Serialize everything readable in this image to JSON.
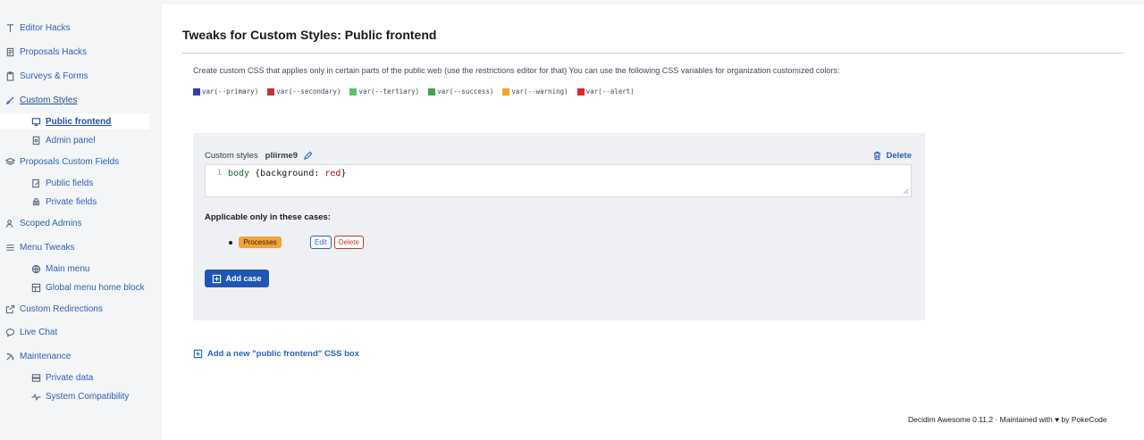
{
  "sidebar": {
    "items": [
      {
        "label": "Editor Hacks",
        "icon": "text-icon",
        "level": 1
      },
      {
        "label": "Proposals Hacks",
        "icon": "document-icon",
        "level": 1
      },
      {
        "label": "Surveys & Forms",
        "icon": "clipboard-icon",
        "level": 1
      },
      {
        "label": "Custom Styles",
        "icon": "brush-icon",
        "level": 1,
        "state": "active-parent"
      },
      {
        "label": "Public frontend",
        "icon": "monitor-icon",
        "level": 2,
        "state": "active"
      },
      {
        "label": "Admin panel",
        "icon": "file-icon",
        "level": 2
      },
      {
        "label": "Proposals Custom Fields",
        "icon": "stack-icon",
        "level": 1
      },
      {
        "label": "Public fields",
        "icon": "edit-file-icon",
        "level": 2
      },
      {
        "label": "Private fields",
        "icon": "incognito-icon",
        "level": 2
      },
      {
        "label": "Scoped Admins",
        "icon": "users-icon",
        "level": 1
      },
      {
        "label": "Menu Tweaks",
        "icon": "menu-icon",
        "level": 1
      },
      {
        "label": "Main menu",
        "icon": "globe-icon",
        "level": 2
      },
      {
        "label": "Global menu home block",
        "icon": "layout-icon",
        "level": 2
      },
      {
        "label": "Custom Redirections",
        "icon": "external-link-icon",
        "level": 1
      },
      {
        "label": "Live Chat",
        "icon": "chat-icon",
        "level": 1
      },
      {
        "label": "Maintenance",
        "icon": "tools-icon",
        "level": 1
      },
      {
        "label": "Private data",
        "icon": "database-icon",
        "level": 2
      },
      {
        "label": "System Compatibility",
        "icon": "pulse-icon",
        "level": 2
      }
    ]
  },
  "main": {
    "title": "Tweaks for Custom Styles: Public frontend",
    "description": "Create custom CSS that applies only in certain parts of the public web (use the restrictions editor for that) You can use the following CSS variables for organization customized colors:",
    "css_vars": [
      {
        "label": "var(--primary)",
        "color": "#3b3bb5"
      },
      {
        "label": "var(--secondary)",
        "color": "#b83a3a"
      },
      {
        "label": "var(--tertiary)",
        "color": "#5cc26a"
      },
      {
        "label": "var(--success)",
        "color": "#3aa851"
      },
      {
        "label": "var(--warning)",
        "color": "#f5a623"
      },
      {
        "label": "var(--alert)",
        "color": "#e02727"
      }
    ],
    "box": {
      "label": "Custom styles",
      "name": "pliirme9",
      "delete_label": "Delete",
      "line_number": "1",
      "code_selector": "body",
      "code_open": " {background: ",
      "code_value": "red",
      "code_close": "}",
      "cases_title": "Applicable only in these cases:",
      "cases": [
        {
          "badge": "Processes",
          "edit_label": "Edit",
          "delete_label": "Delete"
        }
      ],
      "add_case_label": "Add case"
    },
    "add_box_label": "Add a new \"public frontend\" CSS box"
  },
  "footer": {
    "text": "Decidim Awesome 0.11.2 · Maintained with ♥ by PokeCode"
  },
  "colors": {
    "link": "#2d62b3",
    "button": "#1f56b3",
    "badge": "#f2a33a",
    "danger": "#c0392b"
  }
}
